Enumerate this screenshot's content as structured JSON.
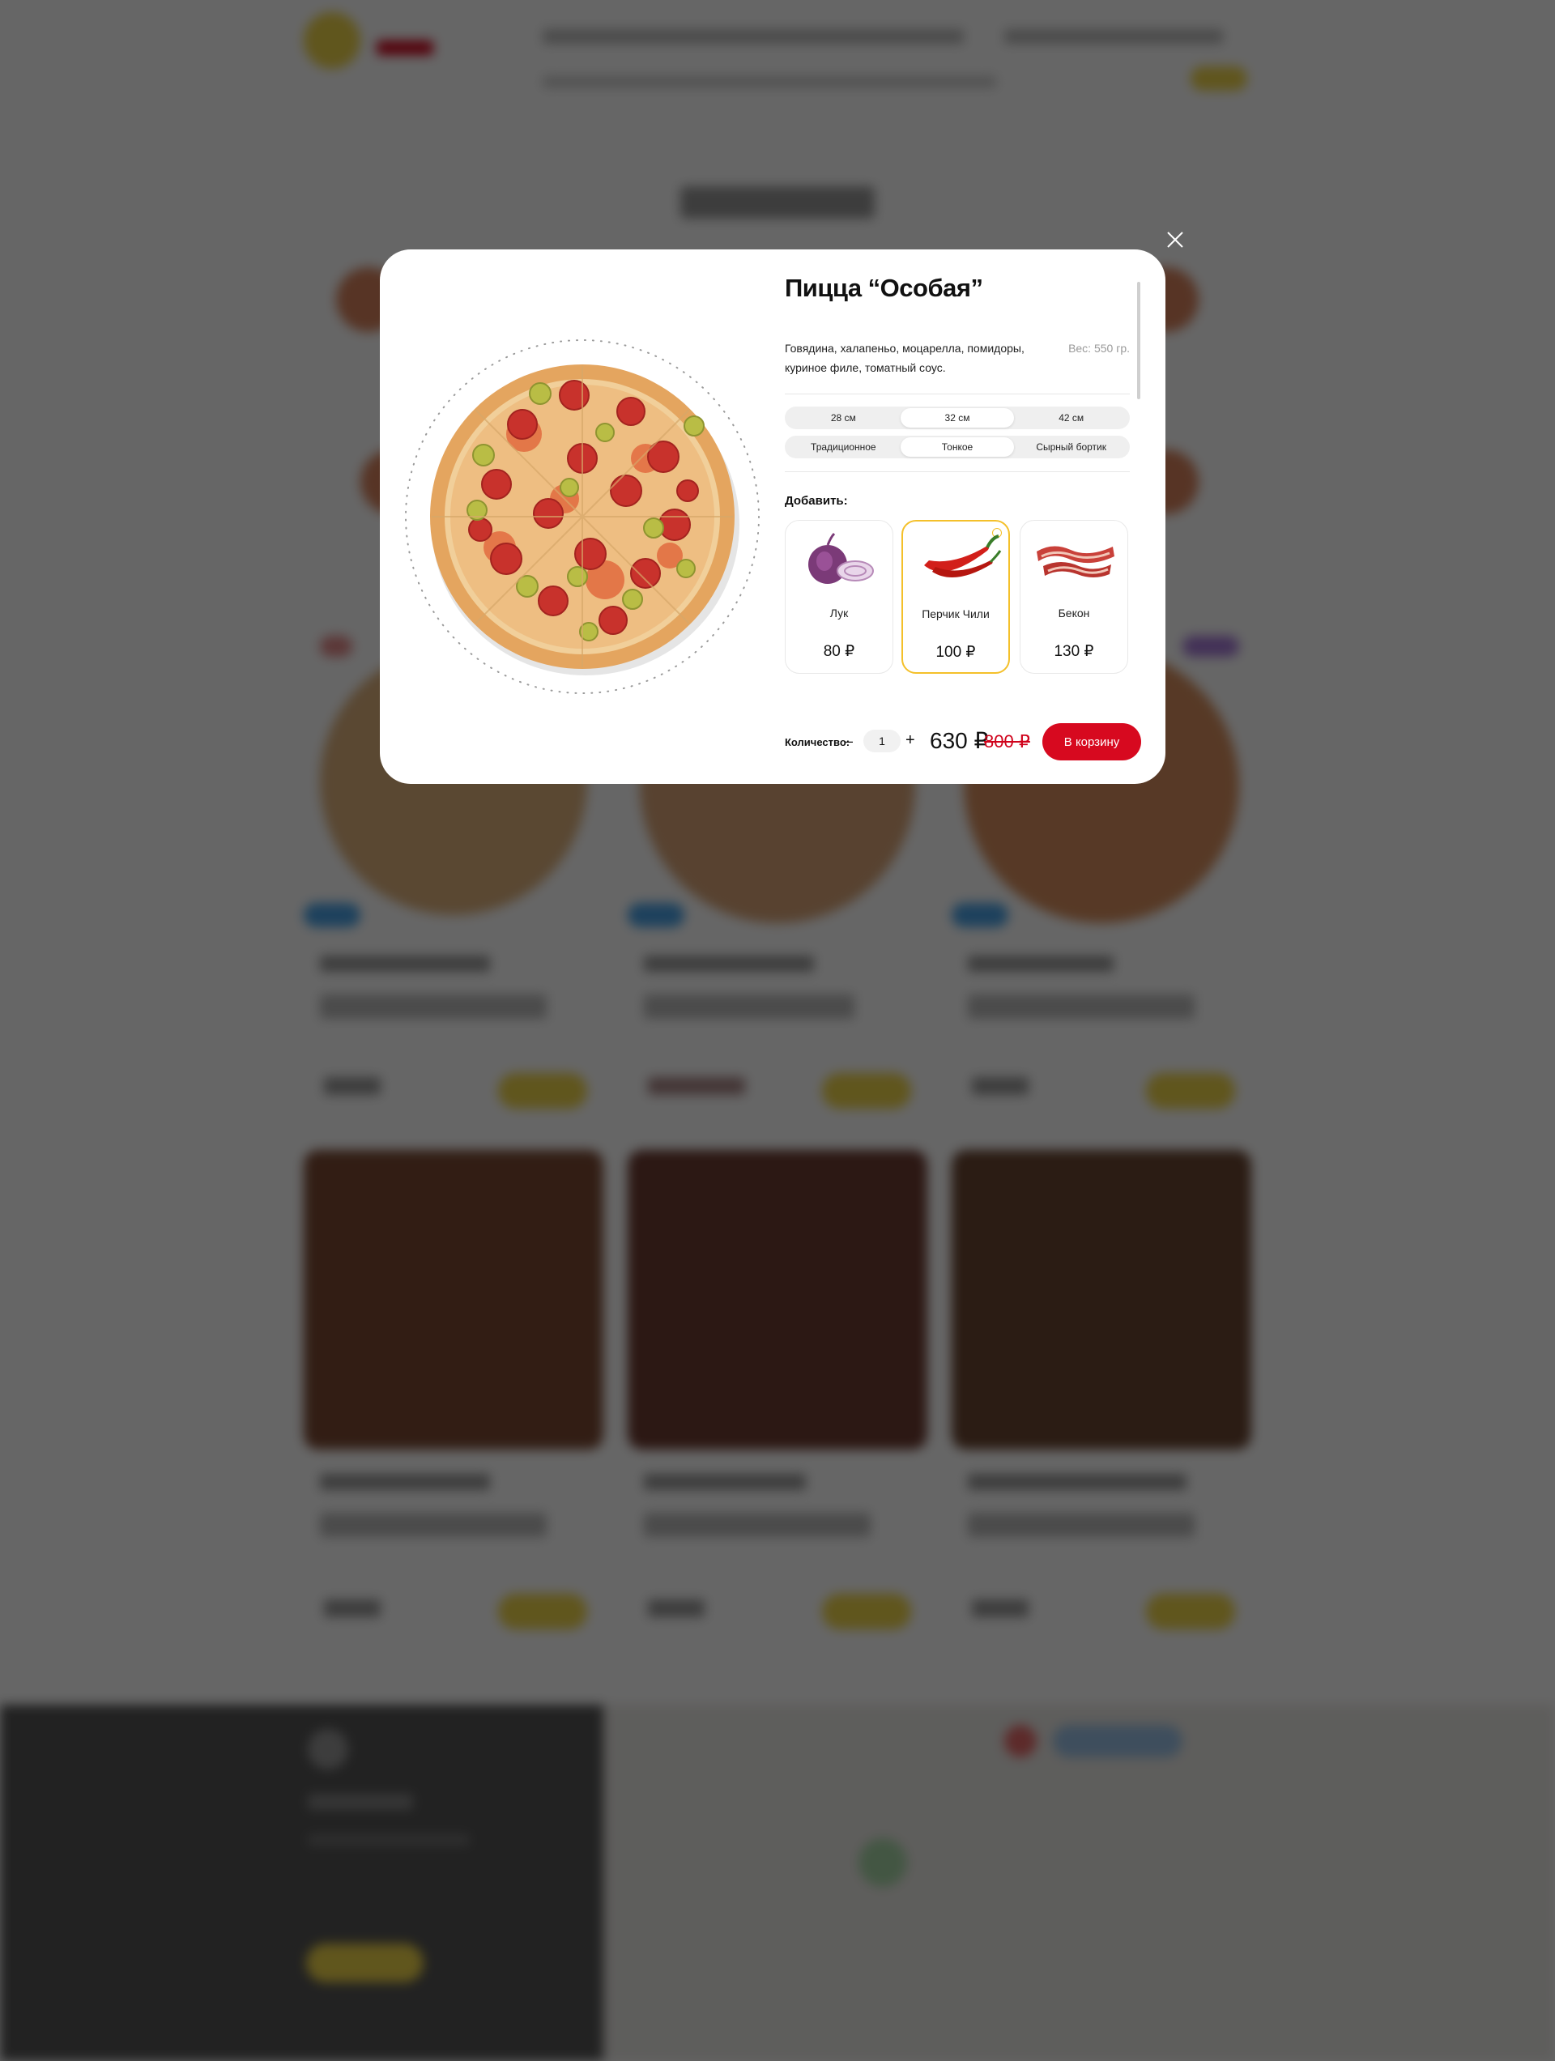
{
  "modal": {
    "title": "Пицца “Особая”",
    "description": "Говядина, халапеньо, моцарелла, помидоры, куриное филе, томатный соус.",
    "weight": "Вес: 550 гр.",
    "sizes": [
      "28 см",
      "32 см",
      "42 см"
    ],
    "selected_size": "32 см",
    "crusts": [
      "Традиционное",
      "Тонкое",
      "Сырный бортик"
    ],
    "selected_crust": "Тонкое",
    "add_title": "Добавить:",
    "toppings": [
      {
        "name": "Лук",
        "price": "80 ₽",
        "icon": "onion-icon"
      },
      {
        "name": "Перчик Чили",
        "price": "100 ₽",
        "icon": "chili-pepper-icon",
        "selected": true
      },
      {
        "name": "Бекон",
        "price": "130 ₽",
        "icon": "bacon-icon"
      },
      {
        "name": "",
        "price": "",
        "icon": "cheese-icon"
      },
      {
        "name": "",
        "price": "",
        "icon": "sauce-icon"
      }
    ],
    "quantity_label": "Количество:",
    "minus": "–",
    "quantity": "1",
    "plus": "+",
    "price": "630 ₽",
    "old_price": "800 ₽",
    "cart_button": "В корзину"
  },
  "colors": {
    "accent_red": "#d7091f",
    "accent_yellow": "#f4c02a",
    "overlay": "rgba(0,0,0,0.6)"
  }
}
